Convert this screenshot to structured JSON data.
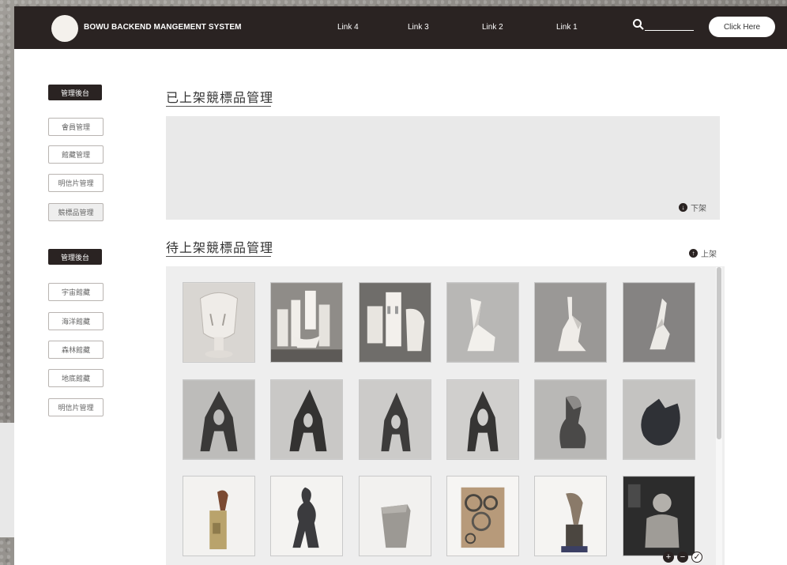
{
  "navbar": {
    "brand": "BOWU BACKEND MANGEMENT SYSTEM",
    "links": [
      "Link 4",
      "Link 3",
      "Link 2",
      "Link 1"
    ],
    "cta": "Click Here"
  },
  "sidebar": {
    "group1": {
      "title": "管理後台",
      "items": [
        "會員管理",
        "館藏管理",
        "明信片管理",
        "競標品管理"
      ]
    },
    "group2": {
      "title": "管理後台",
      "items": [
        "宇宙館藏",
        "海洋館藏",
        "森林館藏",
        "地底館藏",
        "明信片管理"
      ]
    }
  },
  "listed": {
    "heading": "已上架競標品管理",
    "action": "下架"
  },
  "pending": {
    "heading": "待上架競標品管理",
    "action": "上架"
  },
  "colors": {
    "navbar": "#2a2322",
    "panel": "#e9e9e9"
  }
}
